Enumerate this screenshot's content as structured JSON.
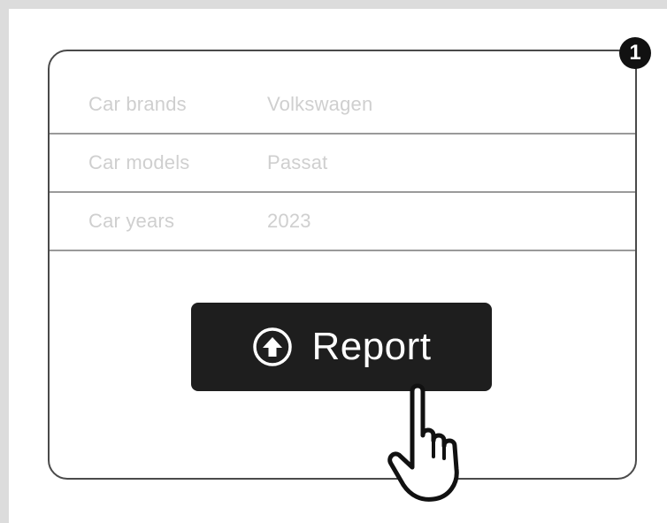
{
  "step_badge": "1",
  "details": {
    "rows": [
      {
        "label": "Car brands",
        "value": "Volkswagen"
      },
      {
        "label": "Car models",
        "value": "Passat"
      },
      {
        "label": "Car years",
        "value": "2023"
      }
    ]
  },
  "report_button": {
    "label": "Report",
    "icon": "upload-circle-icon"
  },
  "pointer": {
    "icon": "hand-pointer-icon"
  },
  "colors": {
    "button_bg": "#1e1e1e",
    "badge_bg": "#111111",
    "muted_text": "#cfcfcf",
    "border": "#4a4a4a"
  }
}
